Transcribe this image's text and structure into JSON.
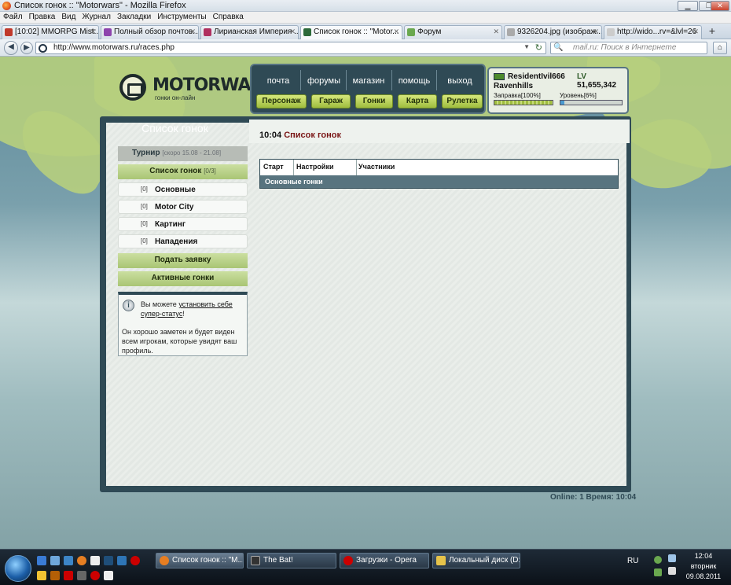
{
  "window": {
    "title": "Список гонок :: \"Motorwars\" - Mozilla Firefox"
  },
  "menu": [
    "Файл",
    "Правка",
    "Вид",
    "Журнал",
    "Закладки",
    "Инструменты",
    "Справка"
  ],
  "tabs": [
    {
      "label": "[10:02] MMORPG Mist:...",
      "color": "#c0392b"
    },
    {
      "label": "Полный обзор почтов...",
      "color": "#8e44ad"
    },
    {
      "label": "Лирианская Империя ...",
      "color": "#b03060"
    },
    {
      "label": "Список гонок :: \"Motor...",
      "color": "#2d6a3a"
    },
    {
      "label": "Форум",
      "color": "#6aa84f"
    },
    {
      "label": "9326204.jpg (изображ...",
      "color": "#aaaaaa"
    },
    {
      "label": "http://wido...rv=&lvl=26",
      "color": "#cccccc"
    }
  ],
  "nav": {
    "url": "http://www.motorwars.ru/races.php",
    "search_placeholder": "mail.ru: Поиск в Интернете"
  },
  "site": {
    "logo": "MOTORWARS.RU",
    "logo_sub": "гонки он-лайн",
    "top_links": [
      "почта",
      "форумы",
      "магазин",
      "помощь",
      "выход"
    ],
    "buttons": [
      "Персонаж",
      "Гараж",
      "Гонки",
      "Карта",
      "Рулетка"
    ],
    "user": {
      "name": "ResidentIvil666",
      "lv_label": "LV",
      "lv_value": "51,655,342",
      "city": "Ravenhills",
      "fuel_label": "Заправка[100%]",
      "fuel": 1.0,
      "level_label": "Уровень[6%]",
      "level": 0.06
    },
    "sidebar_title": "Список гонок",
    "tournament": {
      "label": "Турнир",
      "note": "[скоро 15.08 - 21.08]"
    },
    "race_list": {
      "label": "Список гонок",
      "count": "[0/3]"
    },
    "categories": [
      {
        "count": "[0]",
        "label": "Основные"
      },
      {
        "count": "[0]",
        "label": "Motor City"
      },
      {
        "count": "[0]",
        "label": "Картинг"
      },
      {
        "count": "[0]",
        "label": "Нападения"
      }
    ],
    "apply_button": "Подать заявку",
    "active_button": "Активные гонки",
    "info": {
      "text1": "Вы можете ",
      "link": "установить себе супер-статус",
      "text1_end": "!",
      "text2": "Он хорошо заметен и будет виден всем игрокам, которые увидят ваш профиль."
    },
    "time": "10:04",
    "content_title": "Список гонок",
    "table": {
      "headers": [
        "Старт",
        "Настройки",
        "Участники"
      ],
      "group": "Основные гонки"
    },
    "online": "Online: 1  Время: 10:04"
  },
  "taskbar": {
    "tasks": [
      {
        "label": "Список гонок :: \"M...",
        "color": "#e67e22"
      },
      {
        "label": "The Bat!",
        "color": "#333333"
      },
      {
        "label": "Загрузки - Opera",
        "color": "#cc0000"
      },
      {
        "label": "Локальный диск (D:)",
        "color": "#e6c34a"
      }
    ],
    "lang": "RU",
    "time": "12:04",
    "day": "вторник",
    "date": "09.08.2011"
  }
}
